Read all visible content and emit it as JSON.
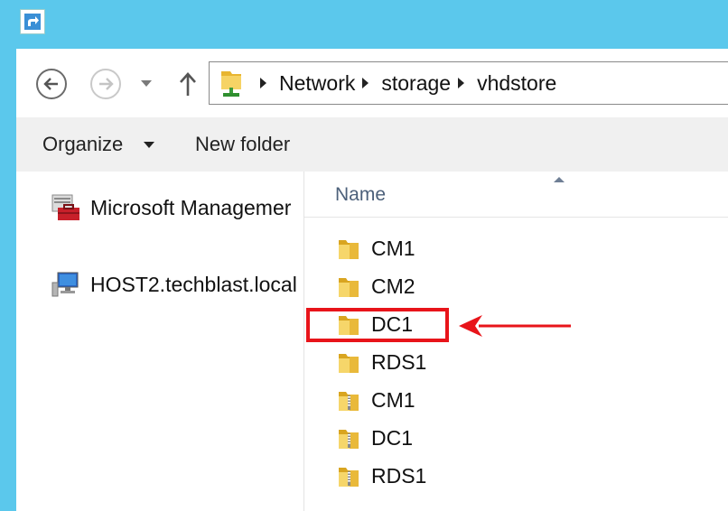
{
  "breadcrumb": {
    "items": [
      "Network",
      "storage",
      "vhdstore"
    ]
  },
  "toolbar": {
    "organize_label": "Organize",
    "new_folder_label": "New folder"
  },
  "nav_pane": {
    "items": [
      {
        "label": "Microsoft Managemer",
        "icon": "mmc-toolbox-icon"
      },
      {
        "label": "HOST2.techblast.local",
        "icon": "computer-icon"
      }
    ]
  },
  "content": {
    "column_header": "Name",
    "files": [
      {
        "name": "CM1",
        "type": "folder"
      },
      {
        "name": "CM2",
        "type": "folder"
      },
      {
        "name": "DC1",
        "type": "folder",
        "highlighted": true
      },
      {
        "name": "RDS1",
        "type": "folder"
      },
      {
        "name": "CM1",
        "type": "zip"
      },
      {
        "name": "DC1",
        "type": "zip"
      },
      {
        "name": "RDS1",
        "type": "zip"
      }
    ]
  },
  "colors": {
    "title_bar": "#5bc8ec",
    "highlight": "#e8141a",
    "folder": "#f2c94c"
  }
}
